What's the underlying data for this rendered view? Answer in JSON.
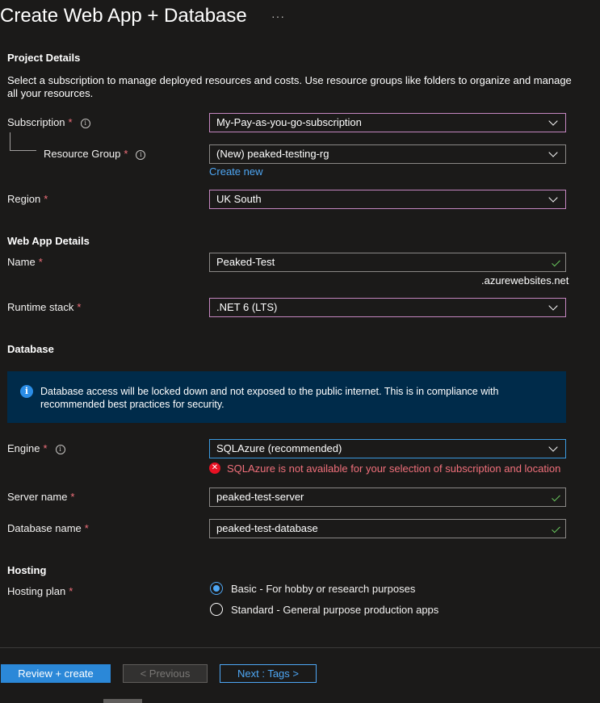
{
  "page": {
    "title": "Create Web App + Database",
    "more_label": "···"
  },
  "project": {
    "heading": "Project Details",
    "description": "Select a subscription to manage deployed resources and costs. Use resource groups like folders to organize and manage all your resources.",
    "subscription_label": "Subscription",
    "subscription_value": "My-Pay-as-you-go-subscription",
    "resource_group_label": "Resource Group",
    "resource_group_value": "(New) peaked-testing-rg",
    "create_new_label": "Create new",
    "region_label": "Region",
    "region_value": "UK South"
  },
  "webapp": {
    "heading": "Web App Details",
    "name_label": "Name",
    "name_value": "Peaked-Test",
    "name_suffix": ".azurewebsites.net",
    "runtime_label": "Runtime stack",
    "runtime_value": ".NET 6 (LTS)"
  },
  "database": {
    "heading": "Database",
    "info_text": "Database access will be locked down and not exposed to the public internet. This is in compliance with recommended best practices for security.",
    "engine_label": "Engine",
    "engine_value": "SQLAzure (recommended)",
    "engine_error": "SQLAzure is not available for your selection of subscription and location",
    "server_label": "Server name",
    "server_value": "peaked-test-server",
    "dbname_label": "Database name",
    "dbname_value": "peaked-test-database"
  },
  "hosting": {
    "heading": "Hosting",
    "plan_label": "Hosting plan",
    "options": [
      {
        "label": "Basic - For hobby or research purposes",
        "selected": true
      },
      {
        "label": "Standard - General purpose production apps",
        "selected": false
      }
    ]
  },
  "footer": {
    "review_label": "Review + create",
    "previous_label": "< Previous",
    "next_label": "Next : Tags >"
  },
  "common": {
    "required_mark": "*",
    "info_glyph": "i",
    "error_glyph": "✕"
  },
  "colors": {
    "background": "#1b1a19",
    "accent": "#2b88d8",
    "link": "#4ea7f5",
    "error": "#f1707b",
    "dropdown_border": "#c586c0",
    "info_banner": "#002b4a",
    "valid_check": "#6ccb5f"
  }
}
